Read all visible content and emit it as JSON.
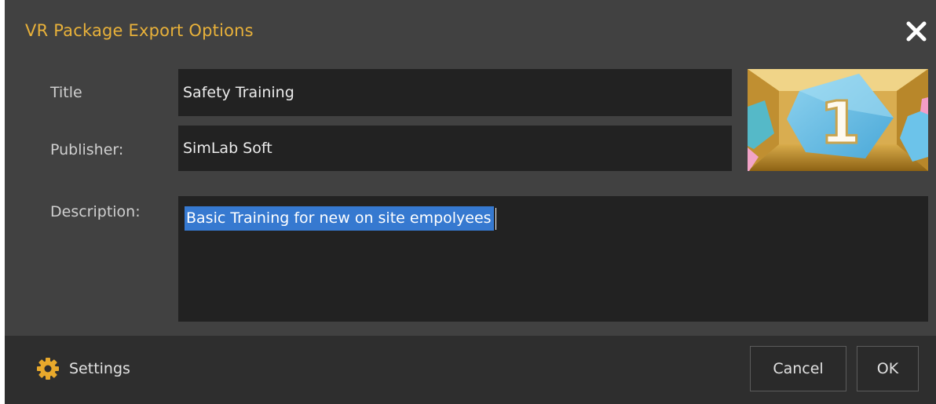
{
  "dialog": {
    "title": "VR Package Export Options",
    "accent_color": "#e8b13a",
    "close_icon": "close-icon"
  },
  "form": {
    "title_label": "Title",
    "title_value": "Safety Training",
    "publisher_label": "Publisher:",
    "publisher_value": "SimLab Soft",
    "description_label": "Description:",
    "description_value": "Basic Training for new on site empolyees",
    "selection_color": "#3679d0"
  },
  "thumbnail": {
    "number": "1"
  },
  "footer": {
    "settings_label": "Settings",
    "settings_icon": "gear-icon",
    "cancel_label": "Cancel",
    "ok_label": "OK"
  }
}
